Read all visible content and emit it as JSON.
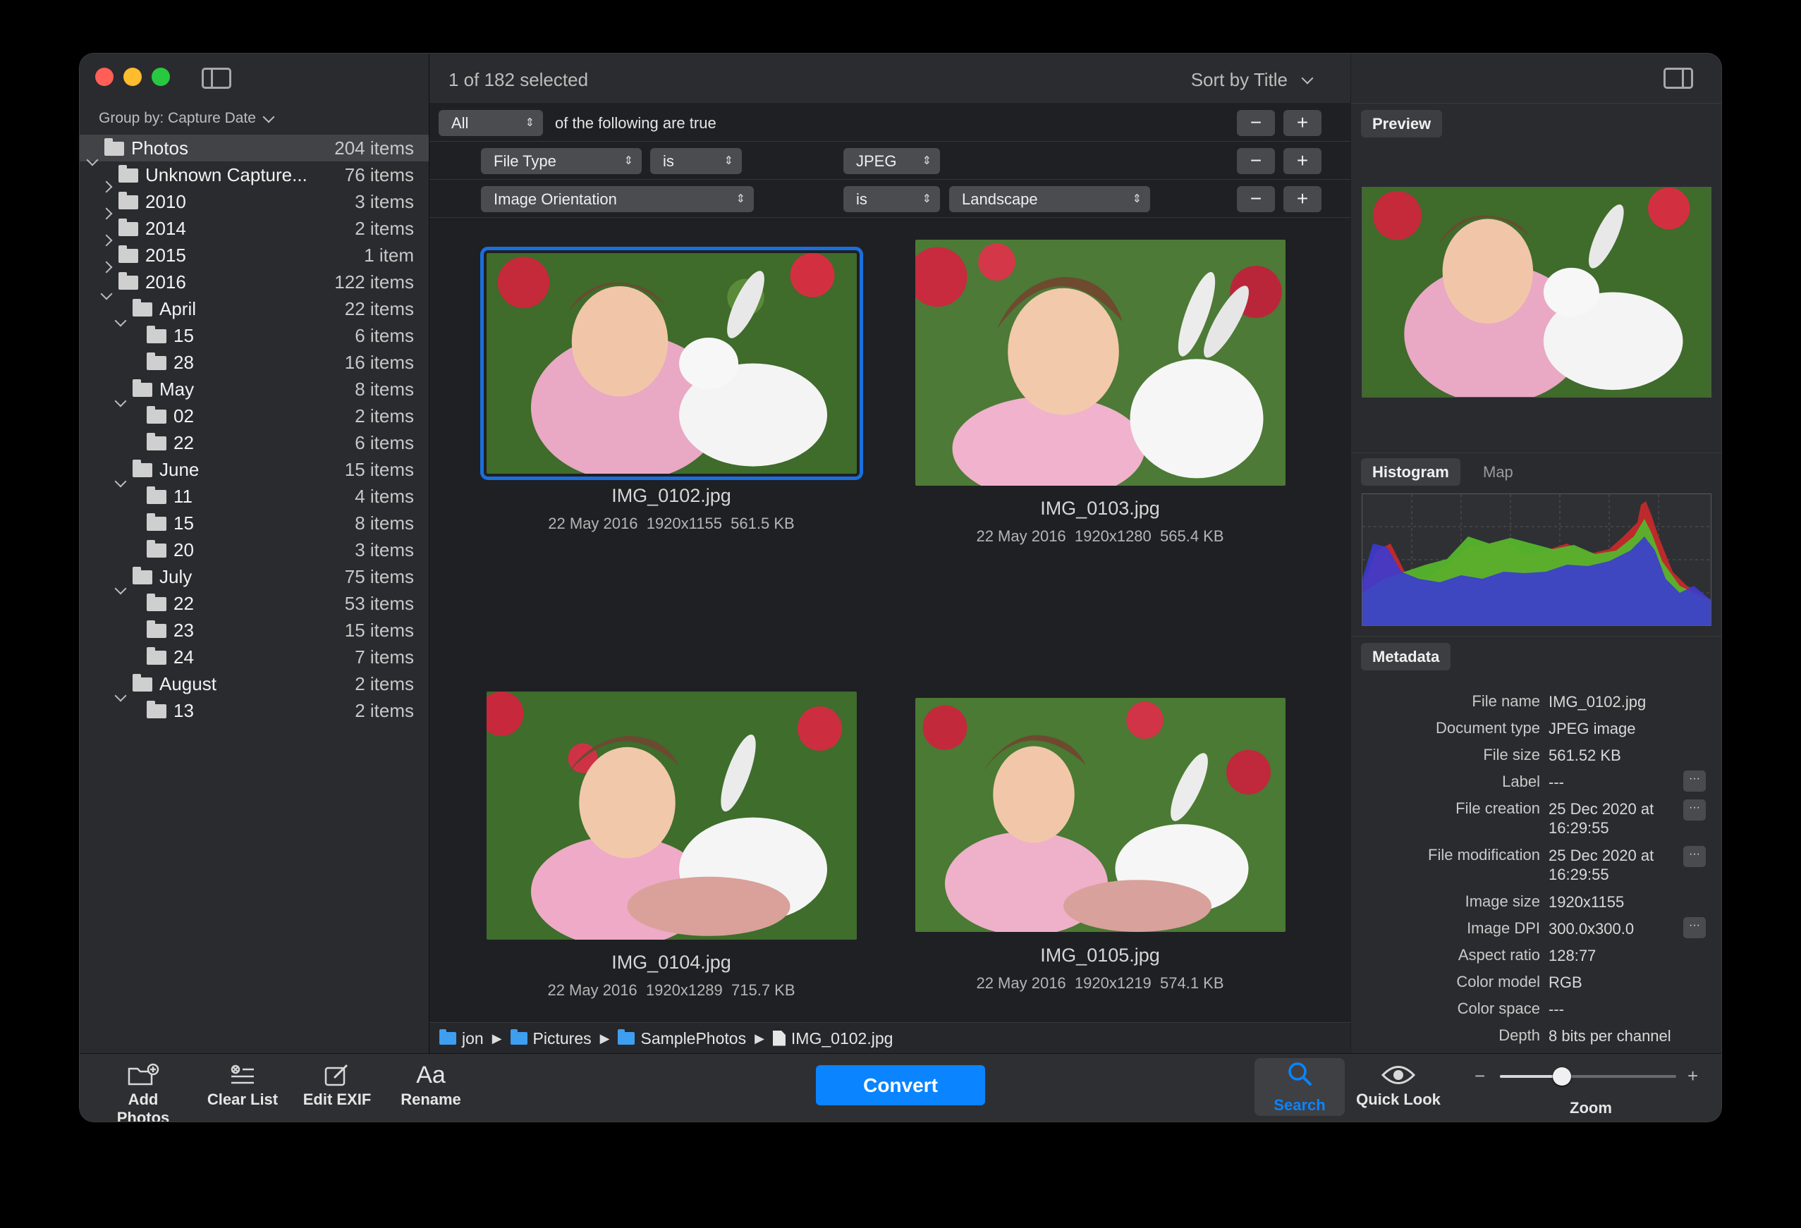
{
  "colors": {
    "accent": "#0a84ff",
    "close": "#ff5f57",
    "minimize": "#febc2e",
    "zoom": "#28c840",
    "selection_outline": "#1a6fdc"
  },
  "sidebar": {
    "group_by": "Group by: Capture Date",
    "items": [
      {
        "name": "Photos",
        "count": "204 items",
        "level": 0,
        "expanded": true
      },
      {
        "name": "Unknown Capture...",
        "count": "76 items",
        "level": 1,
        "expanded": false
      },
      {
        "name": "2010",
        "count": "3 items",
        "level": 1,
        "expanded": false
      },
      {
        "name": "2014",
        "count": "2 items",
        "level": 1,
        "expanded": false
      },
      {
        "name": "2015",
        "count": "1 item",
        "level": 1,
        "expanded": false
      },
      {
        "name": "2016",
        "count": "122 items",
        "level": 1,
        "expanded": true
      },
      {
        "name": "April",
        "count": "22 items",
        "level": 2,
        "expanded": true
      },
      {
        "name": "15",
        "count": "6 items",
        "level": 3
      },
      {
        "name": "28",
        "count": "16 items",
        "level": 3
      },
      {
        "name": "May",
        "count": "8 items",
        "level": 2,
        "expanded": true
      },
      {
        "name": "02",
        "count": "2 items",
        "level": 3
      },
      {
        "name": "22",
        "count": "6 items",
        "level": 3
      },
      {
        "name": "June",
        "count": "15 items",
        "level": 2,
        "expanded": true
      },
      {
        "name": "11",
        "count": "4 items",
        "level": 3
      },
      {
        "name": "15",
        "count": "8 items",
        "level": 3
      },
      {
        "name": "20",
        "count": "3 items",
        "level": 3
      },
      {
        "name": "July",
        "count": "75 items",
        "level": 2,
        "expanded": true
      },
      {
        "name": "22",
        "count": "53 items",
        "level": 3
      },
      {
        "name": "23",
        "count": "15 items",
        "level": 3
      },
      {
        "name": "24",
        "count": "7 items",
        "level": 3
      },
      {
        "name": "August",
        "count": "2 items",
        "level": 2,
        "expanded": true
      },
      {
        "name": "13",
        "count": "2 items",
        "level": 3
      }
    ]
  },
  "main": {
    "selection": "1 of 182 selected",
    "sort": "Sort by Title",
    "filter": {
      "match": "All",
      "match_text": "of the following are true",
      "rules": [
        {
          "field": "File Type",
          "op": "is",
          "value": "JPEG"
        },
        {
          "field": "Image Orientation",
          "op": "is",
          "value": "Landscape"
        }
      ],
      "minus": "−",
      "plus": "+"
    },
    "photos": [
      {
        "name": "IMG_0102.jpg",
        "meta": "22 May 2016  1920x1155  561.5 KB",
        "selected": true
      },
      {
        "name": "IMG_0103.jpg",
        "meta": "22 May 2016  1920x1280  565.4 KB"
      },
      {
        "name": "IMG_0104.jpg",
        "meta": "22 May 2016  1920x1289  715.7 KB"
      },
      {
        "name": "IMG_0105.jpg",
        "meta": "22 May 2016  1920x1219  574.1 KB"
      }
    ],
    "path": [
      "jon",
      "Pictures",
      "SamplePhotos",
      "IMG_0102.jpg"
    ]
  },
  "inspector": {
    "preview_tab": "Preview",
    "histogram_tab": "Histogram",
    "map_tab": "Map",
    "metadata_tab": "Metadata",
    "metadata": [
      {
        "key": "File name",
        "value": "IMG_0102.jpg"
      },
      {
        "key": "Document type",
        "value": "JPEG image"
      },
      {
        "key": "File size",
        "value": "561.52 KB"
      },
      {
        "key": "Label",
        "value": "---",
        "more": true
      },
      {
        "key": "File creation",
        "value": "25 Dec 2020 at 16:29:55",
        "more": true
      },
      {
        "key": "File modification",
        "value": "25 Dec 2020 at 16:29:55",
        "more": true
      },
      {
        "key": "Image size",
        "value": "1920x1155"
      },
      {
        "key": "Image DPI",
        "value": "300.0x300.0",
        "more": true
      },
      {
        "key": "Aspect ratio",
        "value": "128:77"
      },
      {
        "key": "Color model",
        "value": "RGB"
      },
      {
        "key": "Color space",
        "value": "---"
      },
      {
        "key": "Depth",
        "value": "8 bits per channel"
      }
    ],
    "more_glyph": "···"
  },
  "toolbar": {
    "add_photos": "Add Photos",
    "clear_list": "Clear List",
    "edit_exif": "Edit EXIF",
    "rename": "Rename",
    "rename_glyph": "Aa",
    "convert": "Convert",
    "search": "Search",
    "quick_look": "Quick Look",
    "zoom": "Zoom",
    "zoom_minus": "−",
    "zoom_plus": "+",
    "zoom_level": 0.35
  }
}
